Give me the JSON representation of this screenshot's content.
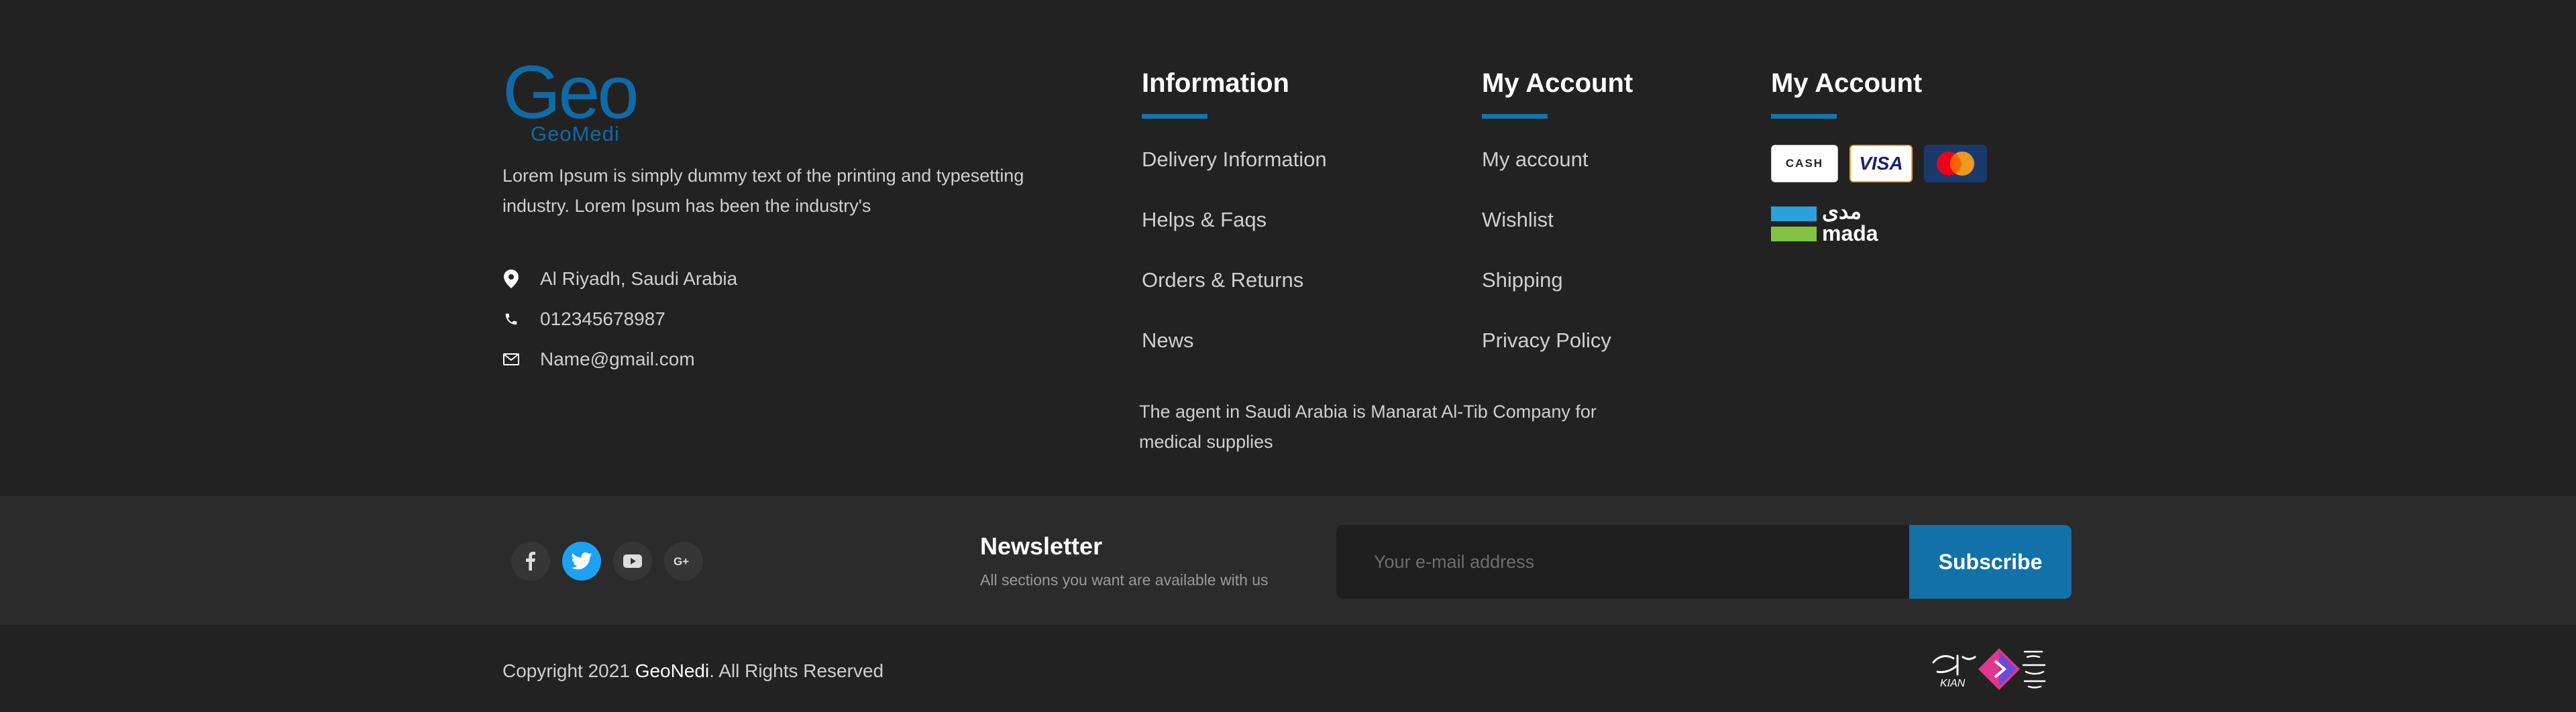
{
  "logo": {
    "main": "Geo",
    "sub": "GeoMedi"
  },
  "about": "Lorem Ipsum is simply dummy text of the printing and typesetting industry. Lorem Ipsum has been the industry's",
  "contact": {
    "address": "Al Riyadh, Saudi Arabia",
    "phone": "012345678987",
    "email": "Name@gmail.com"
  },
  "information": {
    "title": "Information",
    "links": [
      "Delivery Information",
      "Helps & Faqs",
      "Orders & Returns",
      "News"
    ]
  },
  "my_account": {
    "title": "My Account",
    "links": [
      "My account",
      "Wishlist",
      "Shipping",
      "Privacy Policy"
    ]
  },
  "payment": {
    "title": "My Account",
    "cash": "CASH",
    "visa": "VISA",
    "mada_ar": "مدى",
    "mada_en": "mada"
  },
  "agent": "The agent in Saudi Arabia is Manarat Al-Tib Company for medical supplies",
  "newsletter": {
    "title": "Newsletter",
    "subtitle": "All sections you want are available with us",
    "placeholder": "Your e-mail address",
    "button": "Subscribe"
  },
  "social": [
    "facebook-icon",
    "twitter-icon",
    "youtube-icon",
    "google-plus-icon"
  ],
  "copyright": {
    "prefix": "Copyright  2021 ",
    "brand": "GeoNedi",
    "suffix": ". All Rights Reserved"
  },
  "colors": {
    "accent": "#1674b0",
    "twitter": "#1da1f2",
    "background": "#222222",
    "band": "#2b2b2b"
  }
}
